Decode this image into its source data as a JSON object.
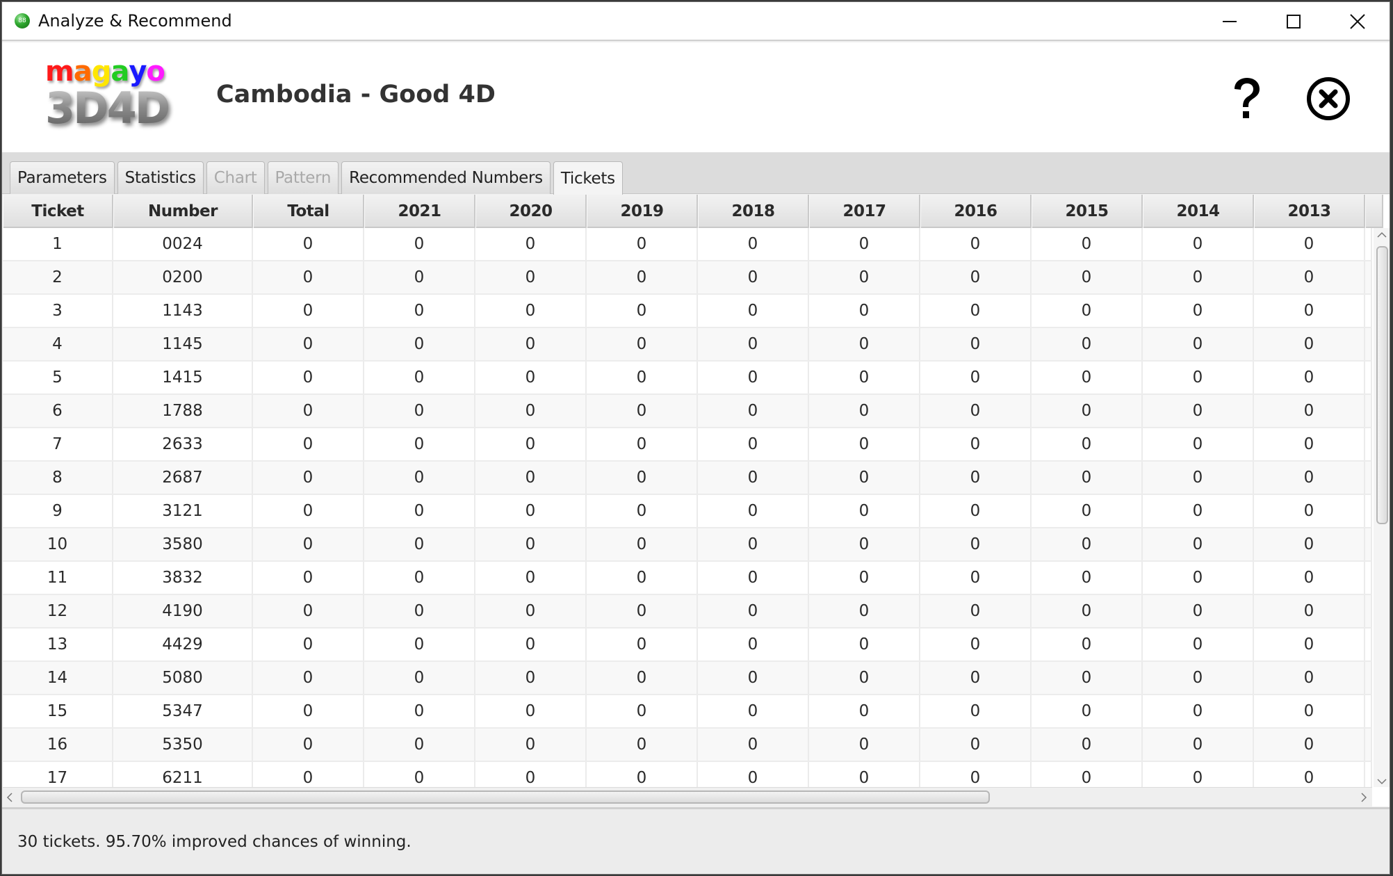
{
  "window": {
    "title": "Analyze & Recommend",
    "app_icon_label": "88",
    "controls": [
      "minimize",
      "maximize",
      "close"
    ]
  },
  "header": {
    "logo_top": [
      "m",
      "a",
      "g",
      "a",
      "y",
      "o"
    ],
    "logo_colors": [
      "#ff1a1a",
      "#ff6a00",
      "#ffe600",
      "#22cc22",
      "#1a1aff",
      "#ff1aff"
    ],
    "logo_bottom": "3D4D",
    "title": "Cambodia - Good 4D",
    "help_icon": "question-mark",
    "exit_icon": "circle-x"
  },
  "tabs": [
    {
      "label": "Parameters",
      "state": "normal"
    },
    {
      "label": "Statistics",
      "state": "normal"
    },
    {
      "label": "Chart",
      "state": "disabled"
    },
    {
      "label": "Pattern",
      "state": "disabled"
    },
    {
      "label": "Recommended Numbers",
      "state": "normal"
    },
    {
      "label": "Tickets",
      "state": "active"
    }
  ],
  "table": {
    "columns": [
      "Ticket",
      "Number",
      "Total",
      "2021",
      "2020",
      "2019",
      "2018",
      "2017",
      "2016",
      "2015",
      "2014",
      "2013"
    ],
    "rows": [
      [
        "1",
        "0024",
        "0",
        "0",
        "0",
        "0",
        "0",
        "0",
        "0",
        "0",
        "0",
        "0"
      ],
      [
        "2",
        "0200",
        "0",
        "0",
        "0",
        "0",
        "0",
        "0",
        "0",
        "0",
        "0",
        "0"
      ],
      [
        "3",
        "1143",
        "0",
        "0",
        "0",
        "0",
        "0",
        "0",
        "0",
        "0",
        "0",
        "0"
      ],
      [
        "4",
        "1145",
        "0",
        "0",
        "0",
        "0",
        "0",
        "0",
        "0",
        "0",
        "0",
        "0"
      ],
      [
        "5",
        "1415",
        "0",
        "0",
        "0",
        "0",
        "0",
        "0",
        "0",
        "0",
        "0",
        "0"
      ],
      [
        "6",
        "1788",
        "0",
        "0",
        "0",
        "0",
        "0",
        "0",
        "0",
        "0",
        "0",
        "0"
      ],
      [
        "7",
        "2633",
        "0",
        "0",
        "0",
        "0",
        "0",
        "0",
        "0",
        "0",
        "0",
        "0"
      ],
      [
        "8",
        "2687",
        "0",
        "0",
        "0",
        "0",
        "0",
        "0",
        "0",
        "0",
        "0",
        "0"
      ],
      [
        "9",
        "3121",
        "0",
        "0",
        "0",
        "0",
        "0",
        "0",
        "0",
        "0",
        "0",
        "0"
      ],
      [
        "10",
        "3580",
        "0",
        "0",
        "0",
        "0",
        "0",
        "0",
        "0",
        "0",
        "0",
        "0"
      ],
      [
        "11",
        "3832",
        "0",
        "0",
        "0",
        "0",
        "0",
        "0",
        "0",
        "0",
        "0",
        "0"
      ],
      [
        "12",
        "4190",
        "0",
        "0",
        "0",
        "0",
        "0",
        "0",
        "0",
        "0",
        "0",
        "0"
      ],
      [
        "13",
        "4429",
        "0",
        "0",
        "0",
        "0",
        "0",
        "0",
        "0",
        "0",
        "0",
        "0"
      ],
      [
        "14",
        "5080",
        "0",
        "0",
        "0",
        "0",
        "0",
        "0",
        "0",
        "0",
        "0",
        "0"
      ],
      [
        "15",
        "5347",
        "0",
        "0",
        "0",
        "0",
        "0",
        "0",
        "0",
        "0",
        "0",
        "0"
      ],
      [
        "16",
        "5350",
        "0",
        "0",
        "0",
        "0",
        "0",
        "0",
        "0",
        "0",
        "0",
        "0"
      ],
      [
        "17",
        "6211",
        "0",
        "0",
        "0",
        "0",
        "0",
        "0",
        "0",
        "0",
        "0",
        "0"
      ]
    ]
  },
  "status": {
    "text": "30 tickets. 95.70% improved chances of winning."
  }
}
